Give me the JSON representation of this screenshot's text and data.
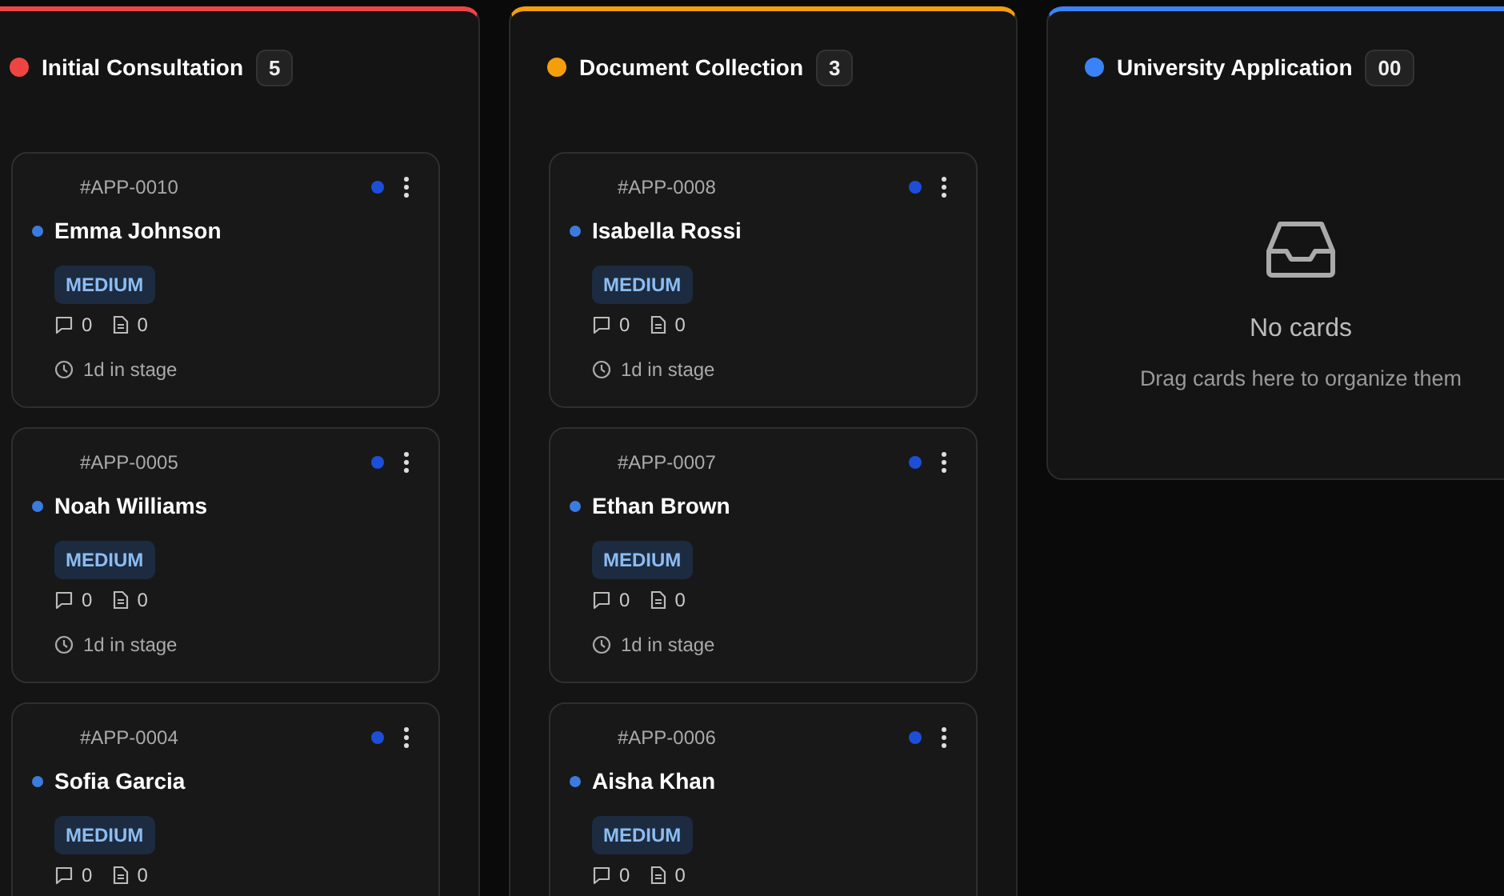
{
  "columns": [
    {
      "title": "Initial Consultation",
      "count": "5",
      "color": "#ef4444",
      "cards": [
        {
          "id": "#APP-0010",
          "name": "Emma Johnson",
          "priority": "MEDIUM",
          "comments": "0",
          "files": "0",
          "stage": "1d in stage"
        },
        {
          "id": "#APP-0005",
          "name": "Noah Williams",
          "priority": "MEDIUM",
          "comments": "0",
          "files": "0",
          "stage": "1d in stage"
        },
        {
          "id": "#APP-0004",
          "name": "Sofia Garcia",
          "priority": "MEDIUM",
          "comments": "0",
          "files": "0"
        }
      ]
    },
    {
      "title": "Document Collection",
      "count": "3",
      "color": "#f59e0b",
      "cards": [
        {
          "id": "#APP-0008",
          "name": "Isabella Rossi",
          "priority": "MEDIUM",
          "comments": "0",
          "files": "0",
          "stage": "1d in stage"
        },
        {
          "id": "#APP-0007",
          "name": "Ethan Brown",
          "priority": "MEDIUM",
          "comments": "0",
          "files": "0",
          "stage": "1d in stage"
        },
        {
          "id": "#APP-0006",
          "name": "Aisha Khan",
          "priority": "MEDIUM",
          "comments": "0",
          "files": "0"
        }
      ]
    },
    {
      "title": "University Application",
      "count": "00",
      "color": "#3b82f6",
      "empty": {
        "title": "No cards",
        "hint": "Drag cards here to organize them"
      }
    }
  ]
}
